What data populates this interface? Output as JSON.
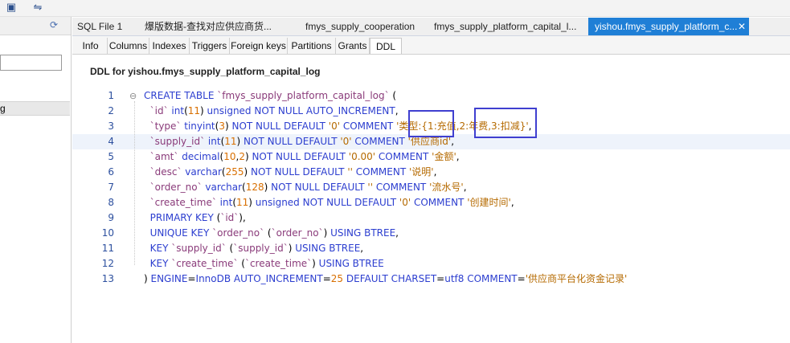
{
  "toolbar": {
    "icons": [
      "query-icon",
      "schema-sync-icon"
    ]
  },
  "left_panel": {
    "item_label": "g"
  },
  "file_tabs": [
    {
      "label": "SQL File 1"
    },
    {
      "label": "爆版数据-查找对应供应商货..."
    },
    {
      "label": "fmys_supply_cooperation"
    },
    {
      "label": "fmys_supply_platform_capital_l..."
    },
    {
      "label": "yishou.fmys_supply_platform_c..."
    }
  ],
  "active_file_tab_close": "✕",
  "sub_tabs": [
    "Info",
    "Columns",
    "Indexes",
    "Triggers",
    "Foreign keys",
    "Partitions",
    "Grants",
    "DDL"
  ],
  "ddl_title": "DDL for yishou.fmys_supply_platform_capital_log",
  "lines": [
    {
      "n": "1",
      "t": [
        [
          "kw",
          "CREATE TABLE "
        ],
        [
          "id",
          "`fmys_supply_platform_capital_log`"
        ],
        [
          "plain",
          " ("
        ]
      ]
    },
    {
      "n": "2",
      "t": [
        [
          "id",
          "  `id` "
        ],
        [
          "kw",
          "int"
        ],
        [
          "plain",
          "("
        ],
        [
          "num",
          "11"
        ],
        [
          "plain",
          ") "
        ],
        [
          "kw",
          "unsigned NOT NULL AUTO_INCREMENT"
        ],
        [
          "plain",
          ","
        ]
      ]
    },
    {
      "n": "3",
      "t": [
        [
          "id",
          "  `type` "
        ],
        [
          "kw",
          "tinyint"
        ],
        [
          "plain",
          "("
        ],
        [
          "num",
          "3"
        ],
        [
          "plain",
          ") "
        ],
        [
          "kw",
          "NOT NULL DEFAULT "
        ],
        [
          "str",
          "'0'"
        ],
        [
          "kw",
          " COMMENT "
        ],
        [
          "str",
          "'类型:{1:充值,2:年费,3:扣减}'"
        ],
        [
          "plain",
          ","
        ]
      ]
    },
    {
      "n": "4",
      "t": [
        [
          "id",
          "  `supply_id` "
        ],
        [
          "kw",
          "int"
        ],
        [
          "plain",
          "("
        ],
        [
          "num",
          "11"
        ],
        [
          "plain",
          ") "
        ],
        [
          "kw",
          "NOT NULL DEFAULT "
        ],
        [
          "str",
          "'0'"
        ],
        [
          "kw",
          " COMMENT "
        ],
        [
          "str",
          "'供应商id'"
        ],
        [
          "plain",
          ","
        ]
      ]
    },
    {
      "n": "5",
      "t": [
        [
          "id",
          "  `amt` "
        ],
        [
          "kw",
          "decimal"
        ],
        [
          "plain",
          "("
        ],
        [
          "num",
          "10"
        ],
        [
          "plain",
          ","
        ],
        [
          "num",
          "2"
        ],
        [
          "plain",
          ") "
        ],
        [
          "kw",
          "NOT NULL DEFAULT "
        ],
        [
          "str",
          "'0.00'"
        ],
        [
          "kw",
          " COMMENT "
        ],
        [
          "str",
          "'金额'"
        ],
        [
          "plain",
          ","
        ]
      ]
    },
    {
      "n": "6",
      "t": [
        [
          "id",
          "  `desc` "
        ],
        [
          "kw",
          "varchar"
        ],
        [
          "plain",
          "("
        ],
        [
          "num",
          "255"
        ],
        [
          "plain",
          ") "
        ],
        [
          "kw",
          "NOT NULL DEFAULT "
        ],
        [
          "str",
          "''"
        ],
        [
          "kw",
          " COMMENT "
        ],
        [
          "str",
          "'说明'"
        ],
        [
          "plain",
          ","
        ]
      ]
    },
    {
      "n": "7",
      "t": [
        [
          "id",
          "  `order_no` "
        ],
        [
          "kw",
          "varchar"
        ],
        [
          "plain",
          "("
        ],
        [
          "num",
          "128"
        ],
        [
          "plain",
          ") "
        ],
        [
          "kw",
          "NOT NULL DEFAULT "
        ],
        [
          "str",
          "''"
        ],
        [
          "kw",
          " COMMENT "
        ],
        [
          "str",
          "'流水号'"
        ],
        [
          "plain",
          ","
        ]
      ]
    },
    {
      "n": "8",
      "t": [
        [
          "id",
          "  `create_time` "
        ],
        [
          "kw",
          "int"
        ],
        [
          "plain",
          "("
        ],
        [
          "num",
          "11"
        ],
        [
          "plain",
          ") "
        ],
        [
          "kw",
          "unsigned NOT NULL DEFAULT "
        ],
        [
          "str",
          "'0'"
        ],
        [
          "kw",
          " COMMENT "
        ],
        [
          "str",
          "'创建时间'"
        ],
        [
          "plain",
          ","
        ]
      ]
    },
    {
      "n": "9",
      "t": [
        [
          "kw",
          "  PRIMARY KEY "
        ],
        [
          "plain",
          "("
        ],
        [
          "id",
          "`id`"
        ],
        [
          "plain",
          "),"
        ]
      ]
    },
    {
      "n": "10",
      "t": [
        [
          "kw",
          "  UNIQUE KEY "
        ],
        [
          "id",
          "`order_no` "
        ],
        [
          "plain",
          "("
        ],
        [
          "id",
          "`order_no`"
        ],
        [
          "plain",
          ") "
        ],
        [
          "kw",
          "USING BTREE"
        ],
        [
          "plain",
          ","
        ]
      ]
    },
    {
      "n": "11",
      "t": [
        [
          "kw",
          "  KEY "
        ],
        [
          "id",
          "`supply_id` "
        ],
        [
          "plain",
          "("
        ],
        [
          "id",
          "`supply_id`"
        ],
        [
          "plain",
          ") "
        ],
        [
          "kw",
          "USING BTREE"
        ],
        [
          "plain",
          ","
        ]
      ]
    },
    {
      "n": "12",
      "t": [
        [
          "kw",
          "  KEY "
        ],
        [
          "id",
          "`create_time` "
        ],
        [
          "plain",
          "("
        ],
        [
          "id",
          "`create_time`"
        ],
        [
          "plain",
          ") "
        ],
        [
          "kw",
          "USING BTREE"
        ]
      ]
    },
    {
      "n": "13",
      "t": [
        [
          "plain",
          ") "
        ],
        [
          "kw",
          "ENGINE"
        ],
        [
          "plain",
          "="
        ],
        [
          "kw",
          "InnoDB AUTO_INCREMENT"
        ],
        [
          "plain",
          "="
        ],
        [
          "num",
          "25"
        ],
        [
          "kw",
          " DEFAULT CHARSET"
        ],
        [
          "plain",
          "="
        ],
        [
          "kw",
          "utf8 COMMENT"
        ],
        [
          "plain",
          "="
        ],
        [
          "str",
          "'供应商平台化资金记录'"
        ]
      ]
    }
  ]
}
